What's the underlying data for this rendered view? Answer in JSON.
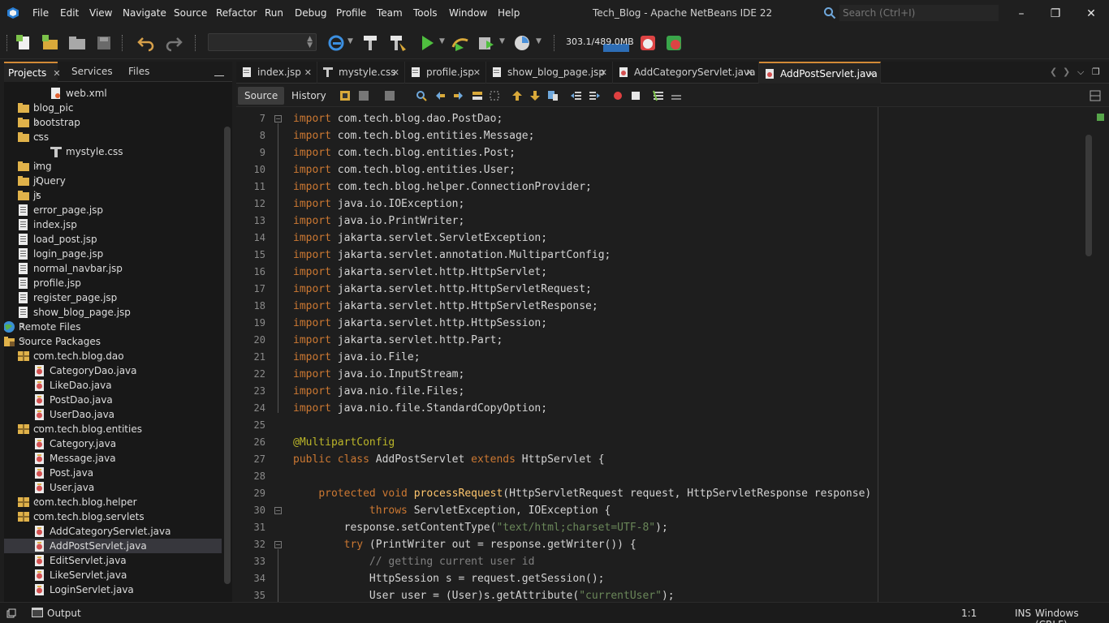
{
  "window": {
    "title": "Tech_Blog - Apache NetBeans IDE 22"
  },
  "menu": [
    "File",
    "Edit",
    "View",
    "Navigate",
    "Source",
    "Refactor",
    "Run",
    "Debug",
    "Profile",
    "Team",
    "Tools",
    "Window",
    "Help"
  ],
  "search": {
    "placeholder": "Search (Ctrl+I)"
  },
  "toolbar": {
    "memory": "303.1/489.0MB"
  },
  "left_tabs": [
    "Projects",
    "Services",
    "Files"
  ],
  "tree": [
    {
      "label": "web.xml",
      "icon": "xml-file-icon"
    },
    {
      "label": "blog_pic",
      "icon": "folder-icon"
    },
    {
      "label": "bootstrap",
      "icon": "folder-icon"
    },
    {
      "label": "css",
      "icon": "folder-icon"
    },
    {
      "label": "mystyle.css",
      "icon": "css-file-icon"
    },
    {
      "label": "img",
      "icon": "folder-icon"
    },
    {
      "label": "jQuery",
      "icon": "folder-icon"
    },
    {
      "label": "js",
      "icon": "folder-icon"
    },
    {
      "label": "error_page.jsp",
      "icon": "jsp-file-icon"
    },
    {
      "label": "index.jsp",
      "icon": "jsp-file-icon"
    },
    {
      "label": "load_post.jsp",
      "icon": "jsp-file-icon"
    },
    {
      "label": "login_page.jsp",
      "icon": "jsp-file-icon"
    },
    {
      "label": "normal_navbar.jsp",
      "icon": "jsp-file-icon"
    },
    {
      "label": "profile.jsp",
      "icon": "jsp-file-icon"
    },
    {
      "label": "register_page.jsp",
      "icon": "jsp-file-icon"
    },
    {
      "label": "show_blog_page.jsp",
      "icon": "jsp-file-icon"
    },
    {
      "label": "Remote Files",
      "icon": "globe-icon"
    },
    {
      "label": "Source Packages",
      "icon": "source-folder-icon"
    },
    {
      "label": "com.tech.blog.dao",
      "icon": "package-icon"
    },
    {
      "label": "CategoryDao.java",
      "icon": "java-file-icon"
    },
    {
      "label": "LikeDao.java",
      "icon": "java-file-icon"
    },
    {
      "label": "PostDao.java",
      "icon": "java-file-icon"
    },
    {
      "label": "UserDao.java",
      "icon": "java-file-icon"
    },
    {
      "label": "com.tech.blog.entities",
      "icon": "package-icon"
    },
    {
      "label": "Category.java",
      "icon": "java-file-icon"
    },
    {
      "label": "Message.java",
      "icon": "java-file-icon"
    },
    {
      "label": "Post.java",
      "icon": "java-file-icon"
    },
    {
      "label": "User.java",
      "icon": "java-file-icon"
    },
    {
      "label": "com.tech.blog.helper",
      "icon": "package-icon"
    },
    {
      "label": "com.tech.blog.servlets",
      "icon": "package-icon"
    },
    {
      "label": "AddCategoryServlet.java",
      "icon": "java-file-icon"
    },
    {
      "label": "AddPostServlet.java",
      "icon": "java-file-icon"
    },
    {
      "label": "EditServlet.java",
      "icon": "java-file-icon"
    },
    {
      "label": "LikeServlet.java",
      "icon": "java-file-icon"
    },
    {
      "label": "LoginServlet.java",
      "icon": "java-file-icon"
    }
  ],
  "editor_tabs": [
    "index.jsp",
    "mystyle.css",
    "profile.jsp",
    "show_blog_page.jsp",
    "AddCategoryServlet.java",
    "AddPostServlet.java"
  ],
  "editor_modes": [
    "Source",
    "History"
  ],
  "code_lines": [
    {
      "n": "7",
      "parts": [
        [
          "kw",
          "import"
        ],
        [
          "ty",
          " com.tech.blog.dao.PostDao;"
        ]
      ]
    },
    {
      "n": "8",
      "parts": [
        [
          "kw",
          "import"
        ],
        [
          "ty",
          " com.tech.blog.entities.Message;"
        ]
      ]
    },
    {
      "n": "9",
      "parts": [
        [
          "kw",
          "import"
        ],
        [
          "ty",
          " com.tech.blog.entities.Post;"
        ]
      ]
    },
    {
      "n": "10",
      "parts": [
        [
          "kw",
          "import"
        ],
        [
          "ty",
          " com.tech.blog.entities.User;"
        ]
      ]
    },
    {
      "n": "11",
      "parts": [
        [
          "kw",
          "import"
        ],
        [
          "ty",
          " com.tech.blog.helper.ConnectionProvider;"
        ]
      ]
    },
    {
      "n": "12",
      "parts": [
        [
          "kw",
          "import"
        ],
        [
          "ty",
          " java.io.IOException;"
        ]
      ]
    },
    {
      "n": "13",
      "parts": [
        [
          "kw",
          "import"
        ],
        [
          "ty",
          " java.io.PrintWriter;"
        ]
      ]
    },
    {
      "n": "14",
      "parts": [
        [
          "kw",
          "import"
        ],
        [
          "ty",
          " jakarta.servlet.ServletException;"
        ]
      ]
    },
    {
      "n": "15",
      "parts": [
        [
          "kw",
          "import"
        ],
        [
          "ty",
          " jakarta.servlet.annotation.MultipartConfig;"
        ]
      ]
    },
    {
      "n": "16",
      "parts": [
        [
          "kw",
          "import"
        ],
        [
          "ty",
          " jakarta.servlet.http.HttpServlet;"
        ]
      ]
    },
    {
      "n": "17",
      "parts": [
        [
          "kw",
          "import"
        ],
        [
          "ty",
          " jakarta.servlet.http.HttpServletRequest;"
        ]
      ]
    },
    {
      "n": "18",
      "parts": [
        [
          "kw",
          "import"
        ],
        [
          "ty",
          " jakarta.servlet.http.HttpServletResponse;"
        ]
      ]
    },
    {
      "n": "19",
      "parts": [
        [
          "kw",
          "import"
        ],
        [
          "ty",
          " jakarta.servlet.http.HttpSession;"
        ]
      ]
    },
    {
      "n": "20",
      "parts": [
        [
          "kw",
          "import"
        ],
        [
          "ty",
          " jakarta.servlet.http.Part;"
        ]
      ]
    },
    {
      "n": "21",
      "parts": [
        [
          "kw",
          "import"
        ],
        [
          "ty",
          " java.io.File;"
        ]
      ]
    },
    {
      "n": "22",
      "parts": [
        [
          "kw",
          "import"
        ],
        [
          "ty",
          " java.io.InputStream;"
        ]
      ]
    },
    {
      "n": "23",
      "parts": [
        [
          "kw",
          "import"
        ],
        [
          "ty",
          " java.nio.file.Files;"
        ]
      ]
    },
    {
      "n": "24",
      "parts": [
        [
          "kw",
          "import"
        ],
        [
          "ty",
          " java.nio.file.StandardCopyOption;"
        ]
      ]
    },
    {
      "n": "25",
      "parts": []
    },
    {
      "n": "26",
      "parts": [
        [
          "an",
          "@MultipartConfig"
        ]
      ]
    },
    {
      "n": "27",
      "parts": [
        [
          "kw",
          "public class"
        ],
        [
          "ty",
          " AddPostServlet "
        ],
        [
          "kw",
          "extends"
        ],
        [
          "ty",
          " HttpServlet {"
        ]
      ]
    },
    {
      "n": "28",
      "parts": []
    },
    {
      "n": "29",
      "parts": [
        [
          "ty",
          "    "
        ],
        [
          "kw",
          "protected void"
        ],
        [
          "ty",
          " "
        ],
        [
          "fn",
          "processRequest"
        ],
        [
          "ty",
          "(HttpServletRequest request, HttpServletResponse response)"
        ]
      ]
    },
    {
      "n": "30",
      "parts": [
        [
          "ty",
          "            "
        ],
        [
          "kw",
          "throws"
        ],
        [
          "ty",
          " ServletException, IOException {"
        ]
      ]
    },
    {
      "n": "31",
      "parts": [
        [
          "ty",
          "        response.setContentType("
        ],
        [
          "str",
          "\"text/html;charset=UTF-8\""
        ],
        [
          "ty",
          ");"
        ]
      ]
    },
    {
      "n": "32",
      "parts": [
        [
          "ty",
          "        "
        ],
        [
          "kw",
          "try"
        ],
        [
          "ty",
          " (PrintWriter out = response.getWriter()) {"
        ]
      ]
    },
    {
      "n": "33",
      "parts": [
        [
          "ty",
          "            "
        ],
        [
          "cm",
          "// getting current user id"
        ]
      ]
    },
    {
      "n": "34",
      "parts": [
        [
          "ty",
          "            HttpSession s = request.getSession();"
        ]
      ]
    },
    {
      "n": "35",
      "parts": [
        [
          "ty",
          "            User user = (User)s.getAttribute("
        ],
        [
          "str",
          "\"currentUser\""
        ],
        [
          "ty",
          ");"
        ]
      ]
    }
  ],
  "status": {
    "output_label": "Output",
    "caret": "1:1",
    "mode": "INS",
    "line_ending": "Windows (CRLF)"
  }
}
